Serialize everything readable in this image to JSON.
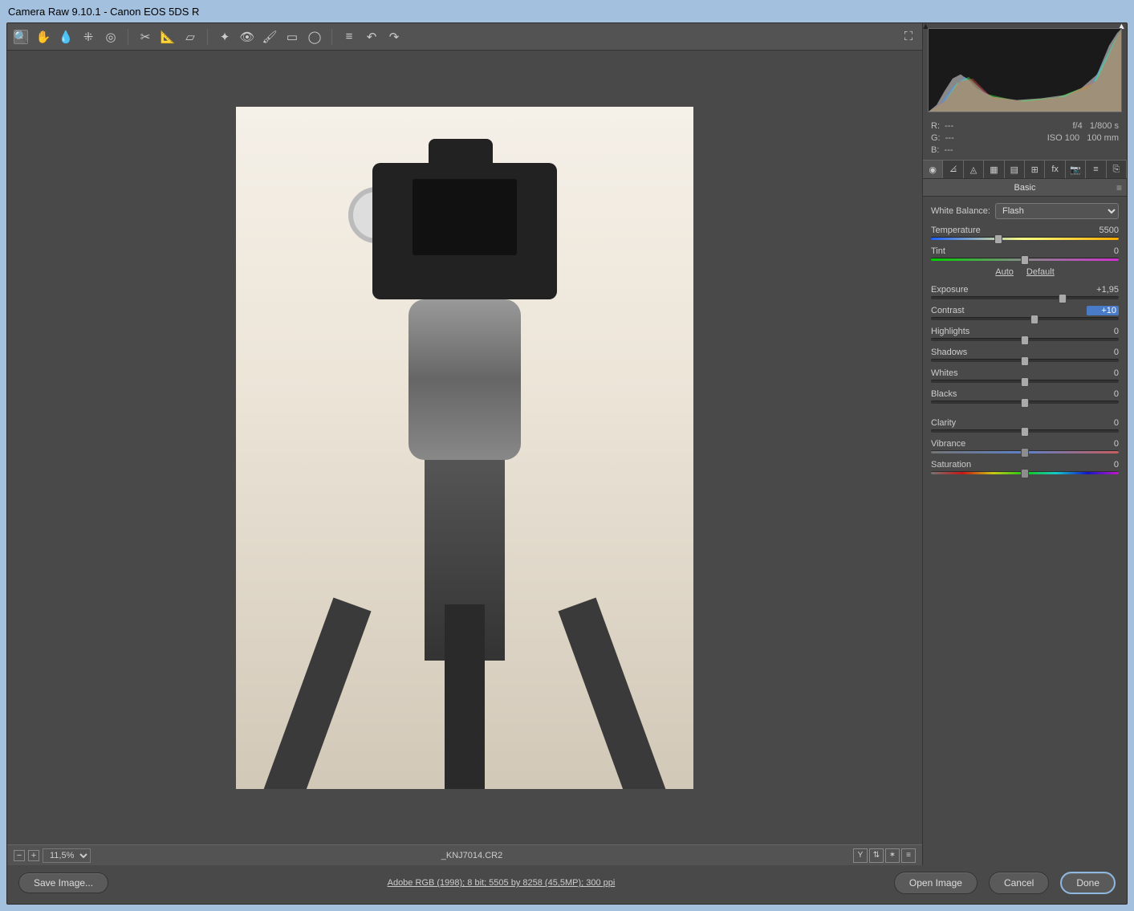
{
  "titlebar": "Camera Raw 9.10.1  -  Canon EOS 5DS R",
  "toolbar": {
    "tools": [
      "zoom",
      "hand",
      "eyedropper-wb",
      "color-sampler",
      "target-adjust",
      "crop",
      "straighten",
      "transform",
      "spot",
      "redeye",
      "brush",
      "grad",
      "radial",
      "preferences",
      "rotate-ccw",
      "rotate-cw"
    ],
    "fullscreen": "⛶"
  },
  "bottom": {
    "zoom": "11,5%",
    "filename": "_KNJ7014.CR2",
    "icons": [
      "Y",
      "⇅",
      "✶",
      "≡"
    ]
  },
  "info": {
    "r": "R:",
    "g": "G:",
    "b": "B:",
    "r_val": "---",
    "g_val": "---",
    "b_val": "---",
    "aperture": "f/4",
    "shutter": "1/800 s",
    "iso": "ISO 100",
    "focal": "100 mm"
  },
  "panel": {
    "title": "Basic",
    "wb_label": "White Balance:",
    "wb_value": "Flash",
    "auto": "Auto",
    "default": "Default",
    "sliders": {
      "temperature": {
        "label": "Temperature",
        "value": "5500",
        "pos": 36
      },
      "tint": {
        "label": "Tint",
        "value": "0",
        "pos": 50
      },
      "exposure": {
        "label": "Exposure",
        "value": "+1,95",
        "pos": 70
      },
      "contrast": {
        "label": "Contrast",
        "value": "+10",
        "pos": 55
      },
      "highlights": {
        "label": "Highlights",
        "value": "0",
        "pos": 50
      },
      "shadows": {
        "label": "Shadows",
        "value": "0",
        "pos": 50
      },
      "whites": {
        "label": "Whites",
        "value": "0",
        "pos": 50
      },
      "blacks": {
        "label": "Blacks",
        "value": "0",
        "pos": 50
      },
      "clarity": {
        "label": "Clarity",
        "value": "0",
        "pos": 50
      },
      "vibrance": {
        "label": "Vibrance",
        "value": "0",
        "pos": 50
      },
      "saturation": {
        "label": "Saturation",
        "value": "0",
        "pos": 50
      }
    }
  },
  "footer": {
    "save": "Save Image...",
    "link": "Adobe RGB (1998); 8 bit; 5505 by 8258 (45,5MP); 300 ppi",
    "open": "Open Image",
    "cancel": "Cancel",
    "done": "Done"
  }
}
